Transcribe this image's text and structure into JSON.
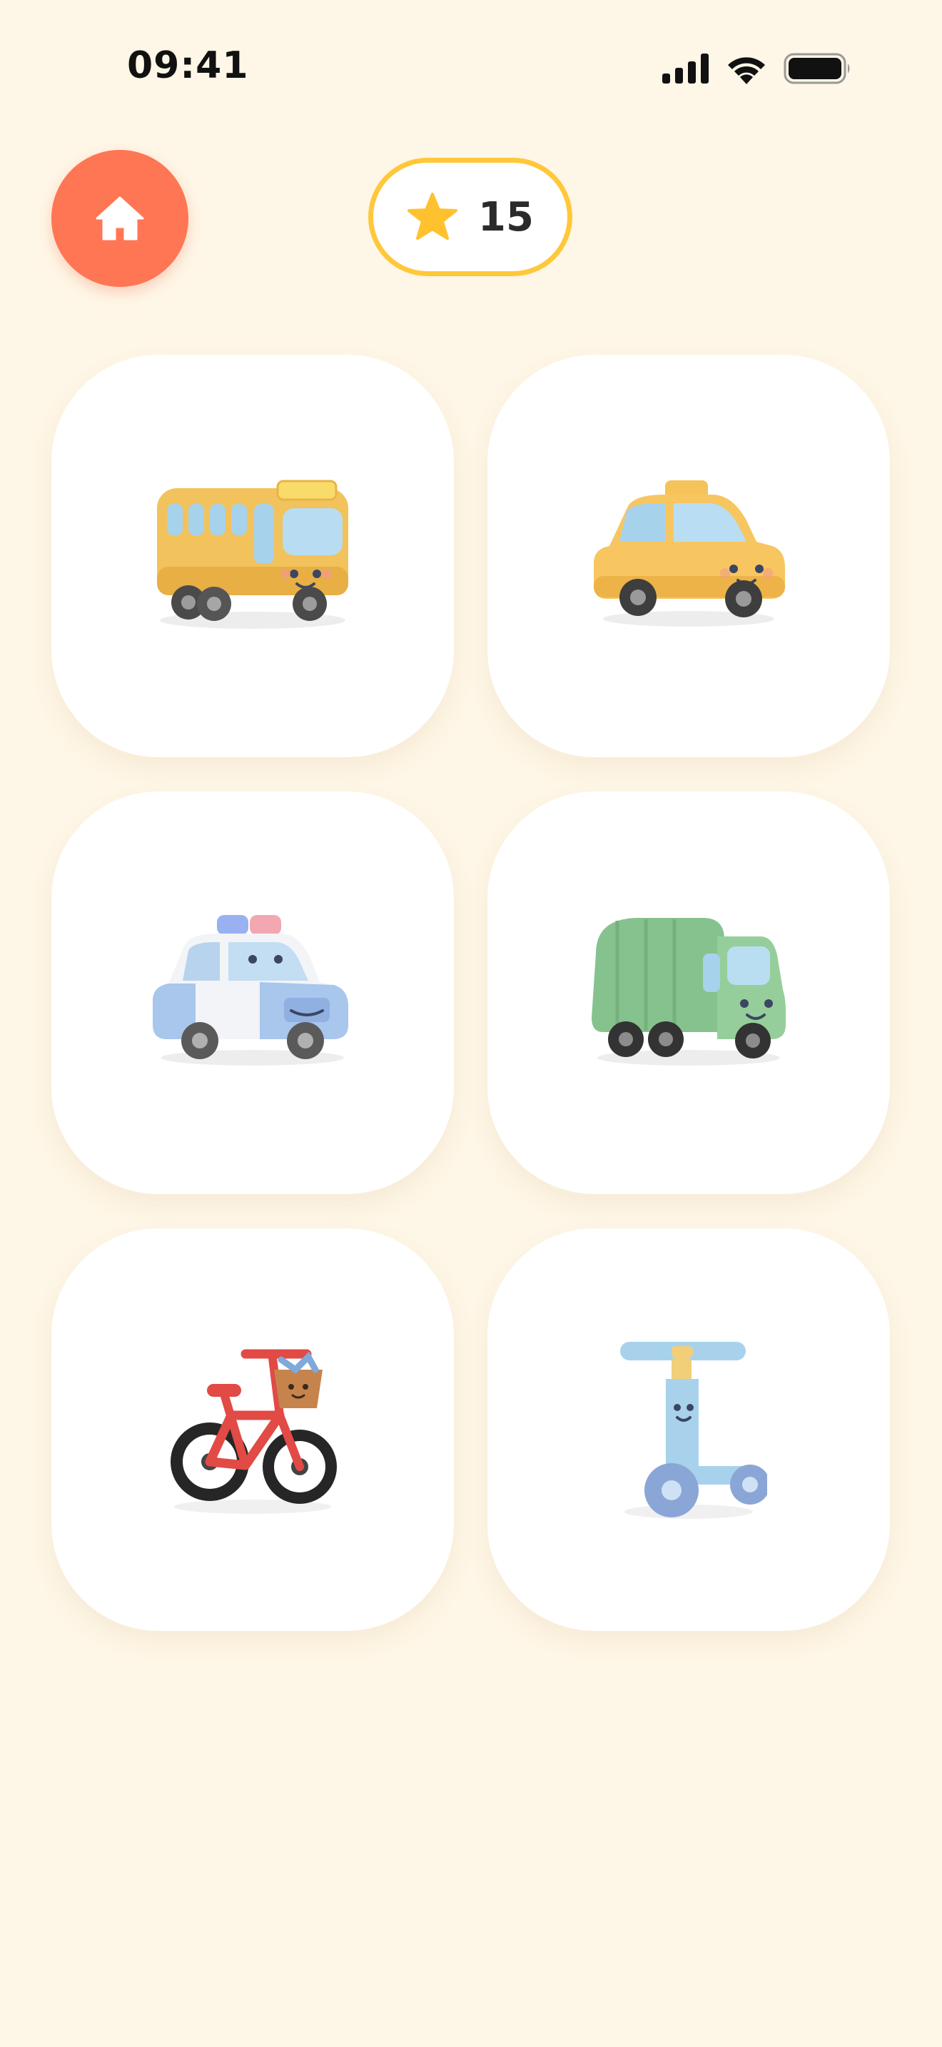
{
  "status_bar": {
    "time": "09:41",
    "icons": [
      "cellular-signal-icon",
      "wifi-icon",
      "battery-icon"
    ]
  },
  "header": {
    "home_icon": "home-icon",
    "score": {
      "icon": "star-icon",
      "value": "15"
    }
  },
  "grid": {
    "items": [
      {
        "vehicle": "bus",
        "color": "#F2C25C"
      },
      {
        "vehicle": "taxi",
        "color": "#F7C660"
      },
      {
        "vehicle": "police-car",
        "color": "#A9C6EC"
      },
      {
        "vehicle": "garbage-truck",
        "color": "#8FCB95"
      },
      {
        "vehicle": "bicycle",
        "color": "#E24A45"
      },
      {
        "vehicle": "scooter",
        "color": "#A8D2EC"
      }
    ]
  },
  "colors": {
    "background": "#FEF6E6",
    "home_button": "#FF7654",
    "score_border": "#FFC83A",
    "star": "#FFC12E"
  }
}
